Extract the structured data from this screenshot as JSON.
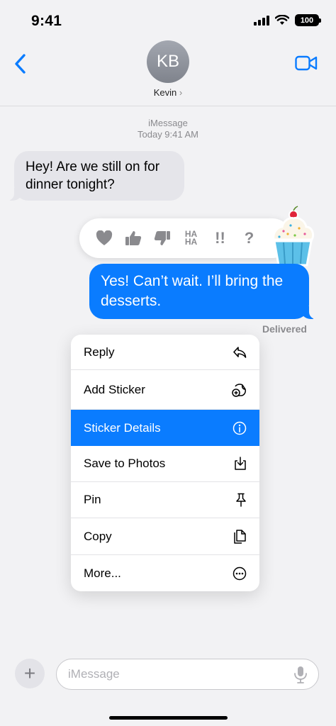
{
  "status": {
    "time": "9:41",
    "battery": "100"
  },
  "header": {
    "avatar_initials": "KB",
    "contact_name": "Kevin",
    "chevron": "›",
    "icons": [
      "back-chevron-icon",
      "facetime-video-icon"
    ]
  },
  "thread": {
    "service": "iMessage",
    "timestamp": "Today 9:41 AM",
    "incoming_message": "Hey! Are we still on for dinner tonight?",
    "outgoing_message": "Yes! Can’t wait. I’ll bring the desserts.",
    "delivery_status": "Delivered"
  },
  "tapbacks": [
    {
      "icon": "heart-icon"
    },
    {
      "icon": "thumbs-up-icon"
    },
    {
      "icon": "thumbs-down-icon"
    },
    {
      "icon": "haha-icon",
      "label_top": "HA",
      "label_bottom": "HA"
    },
    {
      "icon": "exclamation-icon",
      "label": "!!"
    },
    {
      "icon": "question-icon",
      "label": "?"
    }
  ],
  "sticker": {
    "icon": "cupcake-sticker-icon"
  },
  "context_menu": {
    "items": [
      {
        "label": "Reply",
        "icon": "reply-icon"
      },
      {
        "label": "Add Sticker",
        "icon": "add-sticker-icon"
      },
      {
        "label": "Sticker Details",
        "icon": "info-icon",
        "selected": true
      },
      {
        "label": "Save to Photos",
        "icon": "save-download-icon"
      },
      {
        "label": "Pin",
        "icon": "pin-icon"
      },
      {
        "label": "Copy",
        "icon": "copy-icon"
      },
      {
        "label": "More...",
        "icon": "more-ellipsis-icon"
      }
    ]
  },
  "composer": {
    "placeholder": "iMessage",
    "plus": "+",
    "icons": [
      "plus-icon",
      "microphone-icon"
    ]
  },
  "colors": {
    "accent": "#0a7cff",
    "incoming_bubble": "#e5e5ea",
    "background": "#f2f2f4",
    "secondary_text": "#8a8a8e"
  }
}
